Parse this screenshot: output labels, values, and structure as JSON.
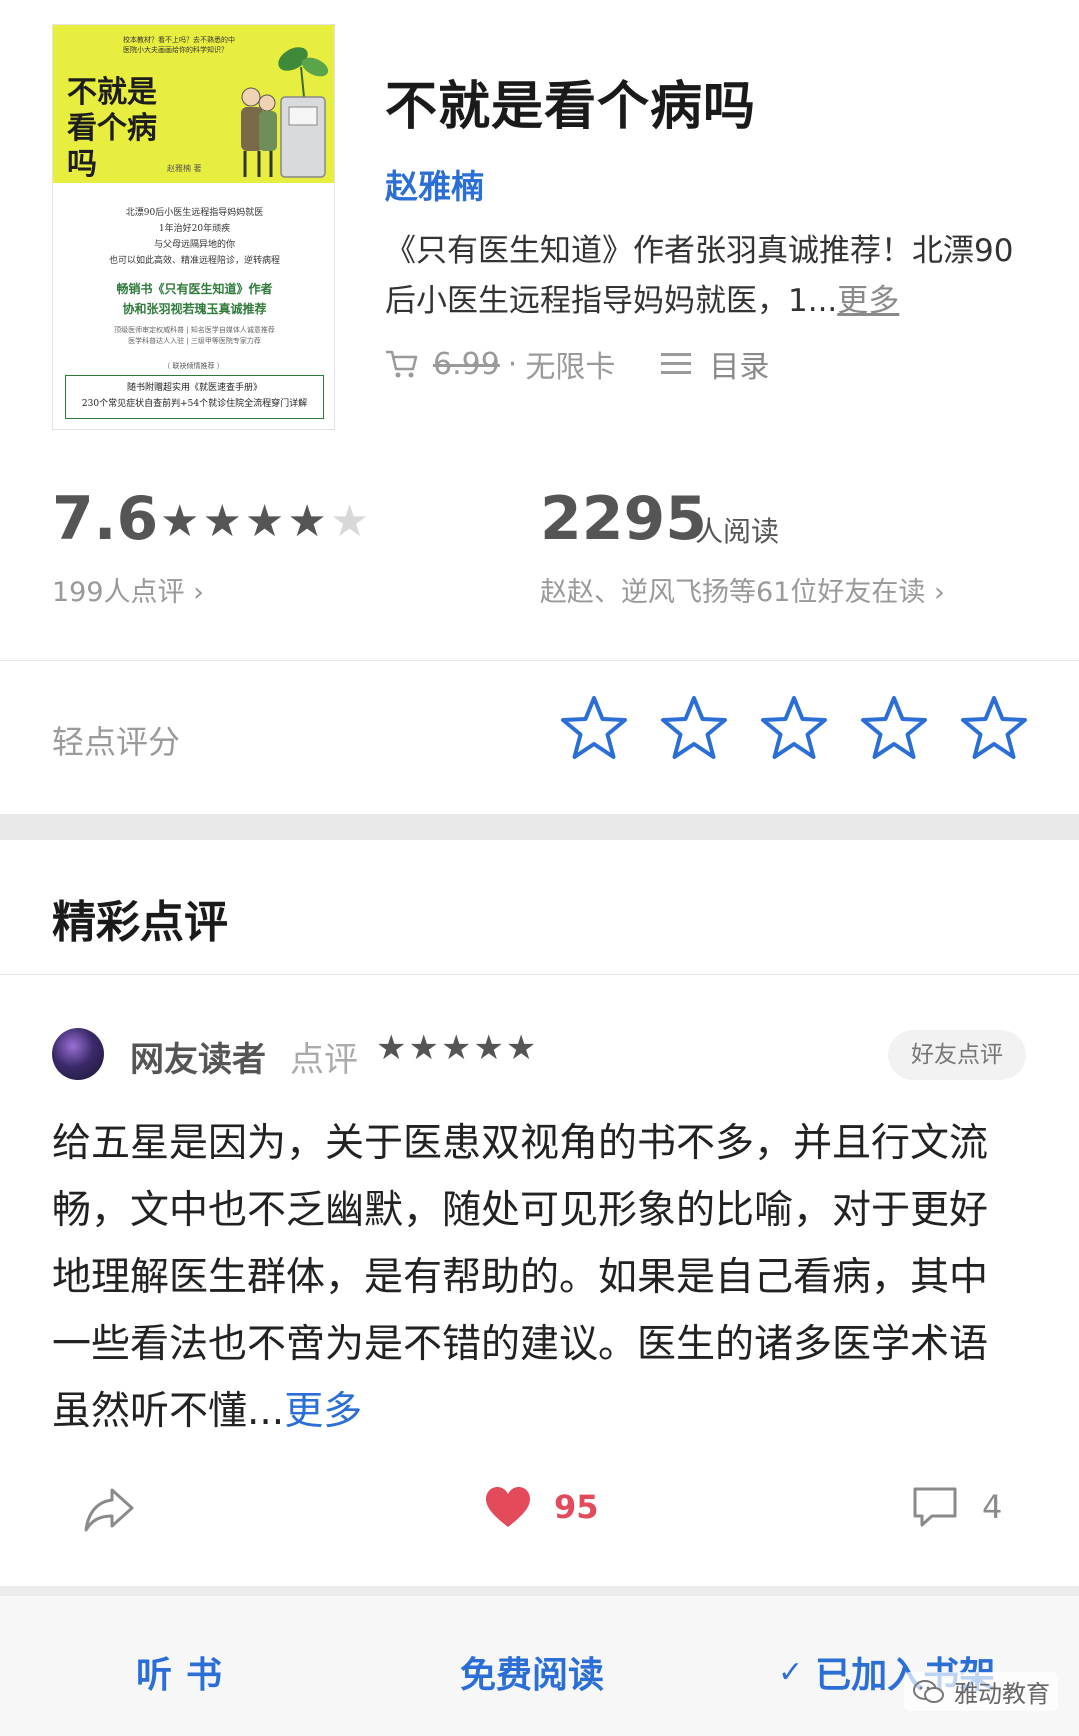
{
  "book": {
    "title": "不就是看个病吗",
    "author": "赵雅楠",
    "description": "《只有医生知道》作者张羽真诚推荐！北漂90后小医生远程指导妈妈就医，1...",
    "more_label": "更多",
    "price_old": "6.99",
    "price_sep": "·",
    "price_plan": "无限卡",
    "toc_label": "目录",
    "cover": {
      "title": "不就是\n看个病吗",
      "tagline": "校本教材？看不上吗？去不熟悉的中\n医院小大夫画画给你的科学知识？",
      "author": "赵雅楠 著",
      "lines": "北漂90后小医生远程指导妈妈就医\n1年治好20年顽疾\n与父母远隔异地的你\n也可以如此高效、精准远程陪诊，逆转病程",
      "promo": "畅销书《只有医生知道》作者\n协和张羽视若瑰玉真诚推荐",
      "fine": "顶级医师审定权威科普 | 知名医学自媒体人诚意推荐\n医学科普达人入驻 | 三级甲等医院专家力荐",
      "recommend": "（ 联袂倾情推荐 ）",
      "box": "随书附赠超实用《就医速查手册》\n230个常见症状自查前判+54个就诊住院全流程穿门详解"
    }
  },
  "stats": {
    "score": "7.6",
    "stars_filled": 4,
    "stars_total": 5,
    "review_count": "199人点评 ›",
    "readers_count": "2295",
    "readers_unit": "人阅读",
    "friends_reading": "赵赵、逆风飞扬等61位好友在读 ›"
  },
  "rate": {
    "label": "轻点评分",
    "star_count": 5,
    "star_color": "#2b6fd6"
  },
  "reviews_section": {
    "title": "精彩点评",
    "items": [
      {
        "reviewer": "网友读者",
        "verb": "点评",
        "stars": "★★★★★",
        "badge": "好友点评",
        "text": "给五星是因为，关于医患双视角的书不多，并且行文流畅，文中也不乏幽默，随处可见形象的比喻，对于更好地理解医生群体，是有帮助的。如果是自己看病，其中一些看法也不啻为是不错的建议。医生的诸多医学术语虽然听不懂...",
        "more_label": "更多",
        "likes": "95",
        "comments": "4"
      }
    ]
  },
  "bottom_bar": {
    "listen": "听书",
    "read_free": "免费阅读",
    "shelf_check": "✓",
    "shelf": "已加入书架"
  },
  "watermark": {
    "text": "雅动教育"
  },
  "colors": {
    "accent": "#2b6fd6",
    "like": "#e34a5a",
    "cover_yellow": "#e8ee3f"
  }
}
